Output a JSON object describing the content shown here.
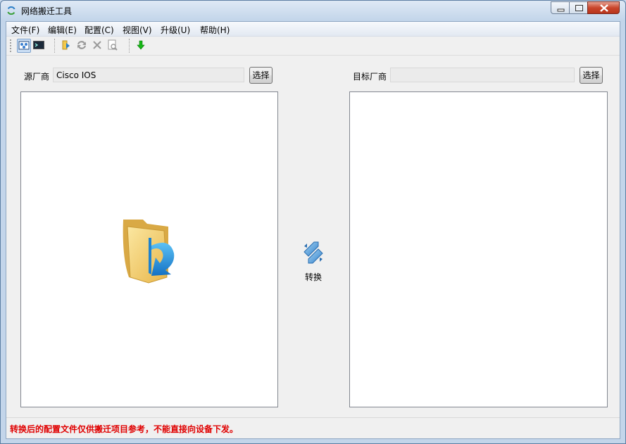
{
  "window": {
    "title": "网络搬迁工具",
    "app_icon": "refresh-arrows-icon",
    "controls": {
      "minimize": "minimize-icon",
      "maximize": "maximize-icon",
      "close": "close-icon"
    }
  },
  "menubar": {
    "items": [
      {
        "label": "文件(F)"
      },
      {
        "label": "编辑(E)"
      },
      {
        "label": "配置(C)"
      },
      {
        "label": "视图(V)"
      },
      {
        "label": "升级(U)"
      },
      {
        "label": "帮助(H)"
      }
    ]
  },
  "toolbar": {
    "buttons": [
      {
        "icon": "graphic-view-icon",
        "pressed": true
      },
      {
        "icon": "terminal-view-icon",
        "pressed": false
      },
      {
        "icon": "open-file-icon",
        "pressed": false
      },
      {
        "icon": "convert-icon",
        "pressed": false
      },
      {
        "icon": "delete-icon",
        "pressed": false
      },
      {
        "icon": "preview-icon",
        "pressed": false
      },
      {
        "icon": "download-icon",
        "pressed": false
      }
    ]
  },
  "source": {
    "label": "源厂商",
    "value": "Cisco IOS",
    "button": "选择",
    "pane_icon": "folder-arrow-icon"
  },
  "target": {
    "label": "目标厂商",
    "value": "",
    "button": "选择"
  },
  "convert": {
    "icon": "convert-arrows-icon",
    "label": "转换"
  },
  "status": {
    "text": "转换后的配置文件仅供搬迁项目参考，不能直接向设备下发。",
    "color": "#e00000"
  }
}
